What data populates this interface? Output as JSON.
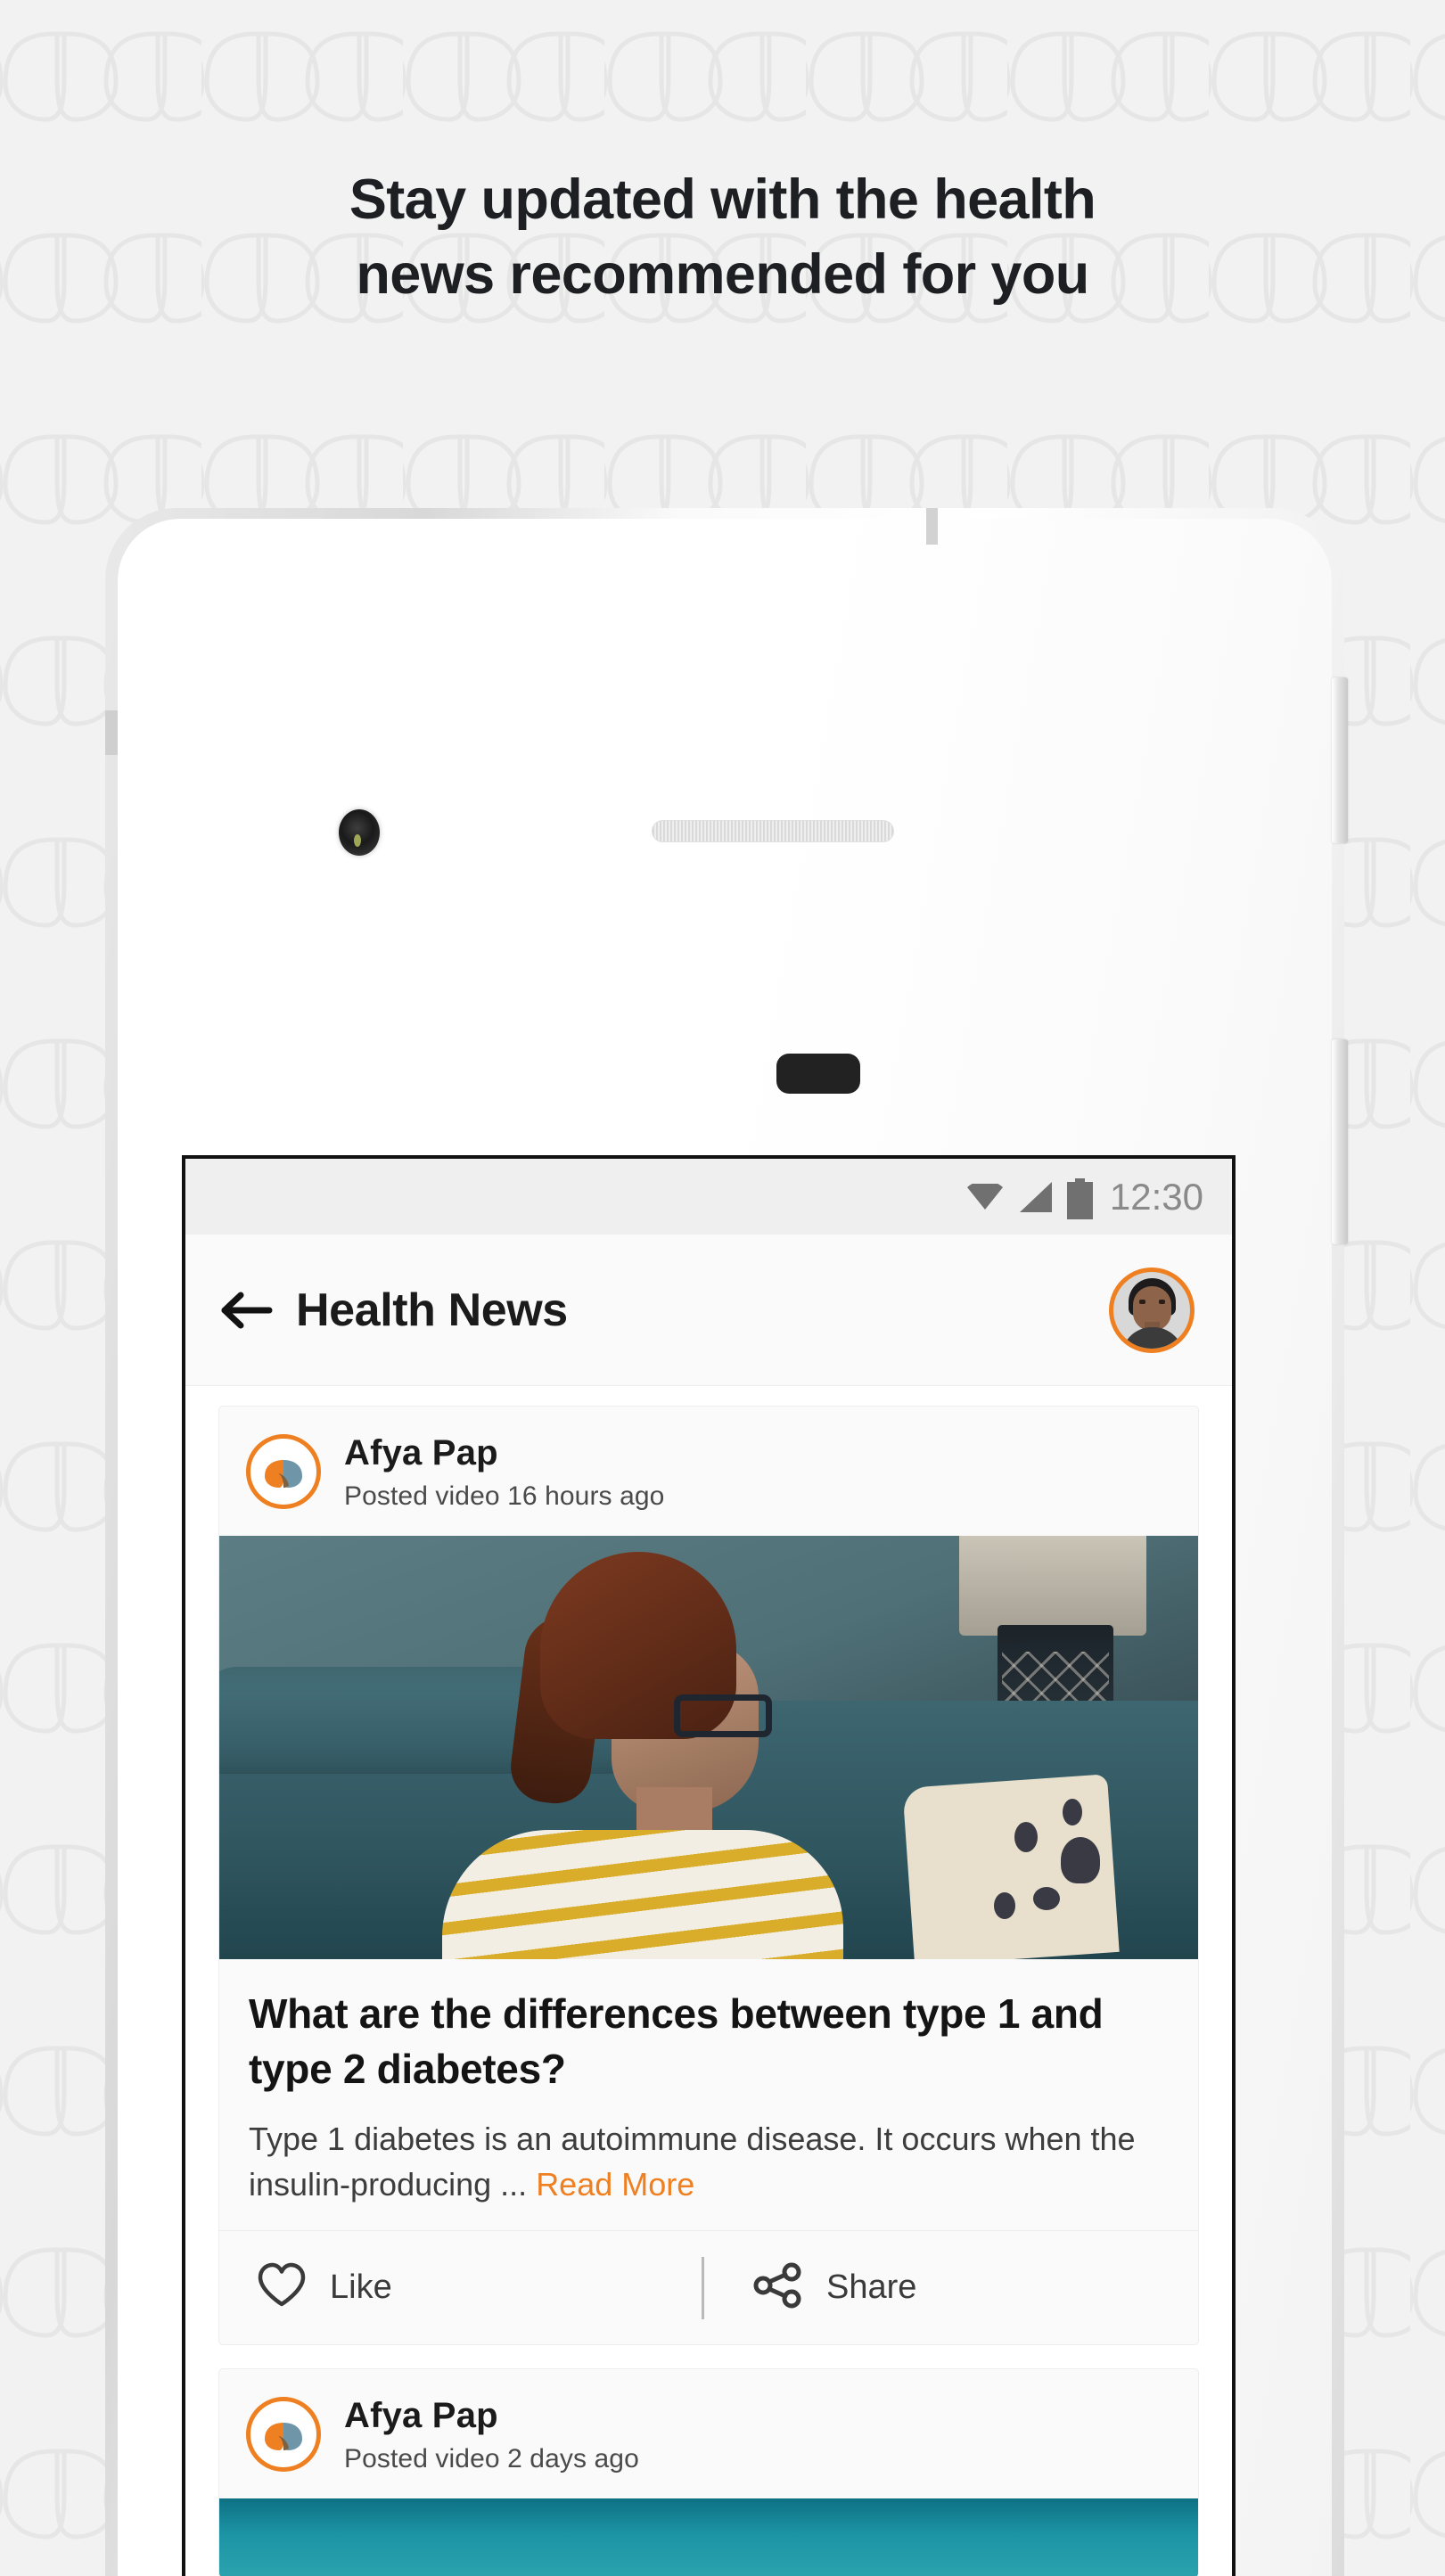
{
  "page": {
    "headline_line1": "Stay updated with the health",
    "headline_line2": "news recommended for you",
    "background_color": "#f2f2f2",
    "accent_color": "#ef8022"
  },
  "phone": {
    "camera_icon": "front-camera",
    "speaker_icon": "earpiece-speaker",
    "sensor_icon": "proximity-sensor",
    "side_button_top": "volume-button",
    "side_button_bottom": "power-button"
  },
  "statusbar": {
    "wifi_icon": "wifi-icon",
    "signal_icon": "cellular-signal-icon",
    "battery_icon": "battery-full-icon",
    "time": "12:30"
  },
  "appbar": {
    "back_icon": "back-arrow-icon",
    "title": "Health News",
    "avatar_name": "user-avatar"
  },
  "feed": {
    "posts": [
      {
        "author": "Afya  Pap",
        "meta": "Posted video 16 hours ago",
        "logo_icon": "afya-pap-leaf-logo",
        "media_alt": "woman-coughing-on-sofa",
        "title": "What are the differences between type 1 and type 2 diabetes?",
        "excerpt": "Type 1 diabetes is an autoimmune disease. It occurs when the insulin-producing ...",
        "read_more": "Read More",
        "like_label": "Like",
        "like_icon": "heart-outline-icon",
        "share_label": "Share",
        "share_icon": "share-nodes-icon"
      },
      {
        "author": "Afya  Pap",
        "meta": "Posted video  2 days ago",
        "logo_icon": "afya-pap-leaf-logo",
        "media_alt": "teal-video-thumbnail"
      }
    ]
  }
}
